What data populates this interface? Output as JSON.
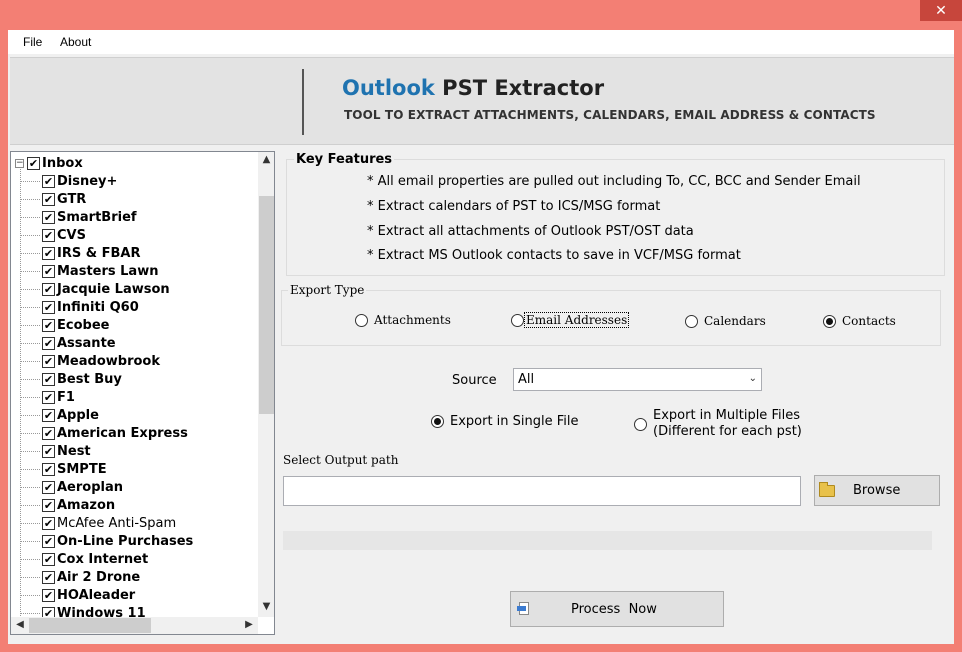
{
  "window": {
    "close_glyph": "✕"
  },
  "menu": {
    "items": [
      "File",
      "About"
    ]
  },
  "banner": {
    "title_part1": "Outlook",
    "title_part2": "PST Extractor",
    "subtitle": "TOOL TO EXTRACT ATTACHMENTS, CALENDARS, EMAIL ADDRESS & CONTACTS"
  },
  "tree": {
    "root": {
      "label": "Inbox",
      "checked": true,
      "expander": "−"
    },
    "items": [
      {
        "label": "Disney+",
        "checked": true,
        "bold": true
      },
      {
        "label": "GTR",
        "checked": true,
        "bold": true
      },
      {
        "label": "SmartBrief",
        "checked": true,
        "bold": true
      },
      {
        "label": "CVS",
        "checked": true,
        "bold": true
      },
      {
        "label": "IRS & FBAR",
        "checked": true,
        "bold": true
      },
      {
        "label": "Masters Lawn",
        "checked": true,
        "bold": true
      },
      {
        "label": "Jacquie Lawson",
        "checked": true,
        "bold": true
      },
      {
        "label": "Infiniti Q60",
        "checked": true,
        "bold": true
      },
      {
        "label": "Ecobee",
        "checked": true,
        "bold": true
      },
      {
        "label": "Assante",
        "checked": true,
        "bold": true
      },
      {
        "label": "Meadowbrook",
        "checked": true,
        "bold": true
      },
      {
        "label": "Best Buy",
        "checked": true,
        "bold": true
      },
      {
        "label": "F1",
        "checked": true,
        "bold": true
      },
      {
        "label": "Apple",
        "checked": true,
        "bold": true
      },
      {
        "label": "American Express",
        "checked": true,
        "bold": true
      },
      {
        "label": "Nest",
        "checked": true,
        "bold": true
      },
      {
        "label": "SMPTE",
        "checked": true,
        "bold": true
      },
      {
        "label": "Aeroplan",
        "checked": true,
        "bold": true
      },
      {
        "label": "Amazon",
        "checked": true,
        "bold": true
      },
      {
        "label": "McAfee Anti-Spam",
        "checked": true,
        "bold": false
      },
      {
        "label": "On-Line Purchases",
        "checked": true,
        "bold": true
      },
      {
        "label": "Cox Internet",
        "checked": true,
        "bold": true
      },
      {
        "label": "Air 2 Drone",
        "checked": true,
        "bold": true
      },
      {
        "label": "HOAleader",
        "checked": true,
        "bold": true
      },
      {
        "label": "Windows 11",
        "checked": true,
        "bold": true
      }
    ],
    "check_glyph": "✔",
    "scroll_up": "▲",
    "scroll_down": "▼",
    "scroll_left": "◀",
    "scroll_right": "▶"
  },
  "features": {
    "legend": "Key Features",
    "items": [
      "* All email properties are pulled out including To, CC, BCC and Sender Email",
      "* Extract calendars of PST to ICS/MSG format",
      "* Extract all attachments of Outlook PST/OST data",
      "* Extract MS Outlook contacts to save in VCF/MSG format"
    ]
  },
  "export_type": {
    "legend": "Export Type",
    "options": [
      {
        "label": "Attachments",
        "selected": false
      },
      {
        "label": "Email Addresses",
        "selected": false,
        "focused": true
      },
      {
        "label": "Calendars",
        "selected": false
      },
      {
        "label": "Contacts",
        "selected": true
      }
    ]
  },
  "source": {
    "label": "Source",
    "value": "All",
    "dropdown_glyph": "⌄"
  },
  "export_mode": {
    "single": {
      "label": "Export in Single File",
      "selected": true
    },
    "multiple": {
      "label_line1": "Export in Multiple Files",
      "label_line2": "(Different for each pst)",
      "selected": false
    }
  },
  "output": {
    "label": "Select Output path",
    "value": "",
    "browse_label": "Browse"
  },
  "progress": {
    "value": 0
  },
  "process": {
    "label": "Process  Now"
  },
  "colors": {
    "title_blue": "#1f73b0",
    "frame": "#f37f74",
    "close": "#c7463c"
  }
}
